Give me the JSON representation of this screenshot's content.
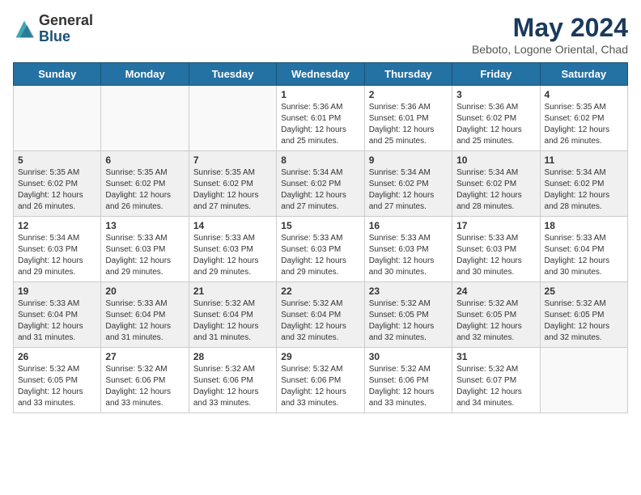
{
  "logo": {
    "general": "General",
    "blue": "Blue"
  },
  "header": {
    "month": "May 2024",
    "location": "Beboto, Logone Oriental, Chad"
  },
  "weekdays": [
    "Sunday",
    "Monday",
    "Tuesday",
    "Wednesday",
    "Thursday",
    "Friday",
    "Saturday"
  ],
  "weeks": [
    [
      {
        "day": "",
        "info": ""
      },
      {
        "day": "",
        "info": ""
      },
      {
        "day": "",
        "info": ""
      },
      {
        "day": "1",
        "info": "Sunrise: 5:36 AM\nSunset: 6:01 PM\nDaylight: 12 hours and 25 minutes."
      },
      {
        "day": "2",
        "info": "Sunrise: 5:36 AM\nSunset: 6:01 PM\nDaylight: 12 hours and 25 minutes."
      },
      {
        "day": "3",
        "info": "Sunrise: 5:36 AM\nSunset: 6:02 PM\nDaylight: 12 hours and 25 minutes."
      },
      {
        "day": "4",
        "info": "Sunrise: 5:35 AM\nSunset: 6:02 PM\nDaylight: 12 hours and 26 minutes."
      }
    ],
    [
      {
        "day": "5",
        "info": "Sunrise: 5:35 AM\nSunset: 6:02 PM\nDaylight: 12 hours and 26 minutes."
      },
      {
        "day": "6",
        "info": "Sunrise: 5:35 AM\nSunset: 6:02 PM\nDaylight: 12 hours and 26 minutes."
      },
      {
        "day": "7",
        "info": "Sunrise: 5:35 AM\nSunset: 6:02 PM\nDaylight: 12 hours and 27 minutes."
      },
      {
        "day": "8",
        "info": "Sunrise: 5:34 AM\nSunset: 6:02 PM\nDaylight: 12 hours and 27 minutes."
      },
      {
        "day": "9",
        "info": "Sunrise: 5:34 AM\nSunset: 6:02 PM\nDaylight: 12 hours and 27 minutes."
      },
      {
        "day": "10",
        "info": "Sunrise: 5:34 AM\nSunset: 6:02 PM\nDaylight: 12 hours and 28 minutes."
      },
      {
        "day": "11",
        "info": "Sunrise: 5:34 AM\nSunset: 6:02 PM\nDaylight: 12 hours and 28 minutes."
      }
    ],
    [
      {
        "day": "12",
        "info": "Sunrise: 5:34 AM\nSunset: 6:03 PM\nDaylight: 12 hours and 29 minutes."
      },
      {
        "day": "13",
        "info": "Sunrise: 5:33 AM\nSunset: 6:03 PM\nDaylight: 12 hours and 29 minutes."
      },
      {
        "day": "14",
        "info": "Sunrise: 5:33 AM\nSunset: 6:03 PM\nDaylight: 12 hours and 29 minutes."
      },
      {
        "day": "15",
        "info": "Sunrise: 5:33 AM\nSunset: 6:03 PM\nDaylight: 12 hours and 29 minutes."
      },
      {
        "day": "16",
        "info": "Sunrise: 5:33 AM\nSunset: 6:03 PM\nDaylight: 12 hours and 30 minutes."
      },
      {
        "day": "17",
        "info": "Sunrise: 5:33 AM\nSunset: 6:03 PM\nDaylight: 12 hours and 30 minutes."
      },
      {
        "day": "18",
        "info": "Sunrise: 5:33 AM\nSunset: 6:04 PM\nDaylight: 12 hours and 30 minutes."
      }
    ],
    [
      {
        "day": "19",
        "info": "Sunrise: 5:33 AM\nSunset: 6:04 PM\nDaylight: 12 hours and 31 minutes."
      },
      {
        "day": "20",
        "info": "Sunrise: 5:33 AM\nSunset: 6:04 PM\nDaylight: 12 hours and 31 minutes."
      },
      {
        "day": "21",
        "info": "Sunrise: 5:32 AM\nSunset: 6:04 PM\nDaylight: 12 hours and 31 minutes."
      },
      {
        "day": "22",
        "info": "Sunrise: 5:32 AM\nSunset: 6:04 PM\nDaylight: 12 hours and 32 minutes."
      },
      {
        "day": "23",
        "info": "Sunrise: 5:32 AM\nSunset: 6:05 PM\nDaylight: 12 hours and 32 minutes."
      },
      {
        "day": "24",
        "info": "Sunrise: 5:32 AM\nSunset: 6:05 PM\nDaylight: 12 hours and 32 minutes."
      },
      {
        "day": "25",
        "info": "Sunrise: 5:32 AM\nSunset: 6:05 PM\nDaylight: 12 hours and 32 minutes."
      }
    ],
    [
      {
        "day": "26",
        "info": "Sunrise: 5:32 AM\nSunset: 6:05 PM\nDaylight: 12 hours and 33 minutes."
      },
      {
        "day": "27",
        "info": "Sunrise: 5:32 AM\nSunset: 6:06 PM\nDaylight: 12 hours and 33 minutes."
      },
      {
        "day": "28",
        "info": "Sunrise: 5:32 AM\nSunset: 6:06 PM\nDaylight: 12 hours and 33 minutes."
      },
      {
        "day": "29",
        "info": "Sunrise: 5:32 AM\nSunset: 6:06 PM\nDaylight: 12 hours and 33 minutes."
      },
      {
        "day": "30",
        "info": "Sunrise: 5:32 AM\nSunset: 6:06 PM\nDaylight: 12 hours and 33 minutes."
      },
      {
        "day": "31",
        "info": "Sunrise: 5:32 AM\nSunset: 6:07 PM\nDaylight: 12 hours and 34 minutes."
      },
      {
        "day": "",
        "info": ""
      }
    ]
  ]
}
